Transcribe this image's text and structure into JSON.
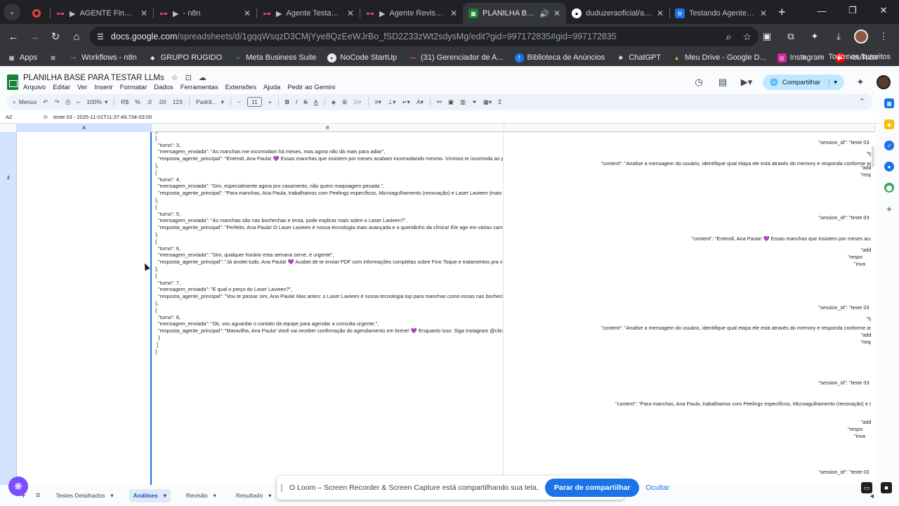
{
  "browser": {
    "tabs": [
      {
        "label": "",
        "icon": "record-icon",
        "pinned": true
      },
      {
        "label": "AGENTE Fino Toque",
        "icon": "n8n-icon",
        "prefix": "▶"
      },
      {
        "label": "- n8n",
        "icon": "n8n-icon",
        "prefix": "▶"
      },
      {
        "label": "Agente Testador de",
        "icon": "n8n-icon",
        "prefix": "▶"
      },
      {
        "label": "Agente Revisador d",
        "icon": "n8n-icon",
        "prefix": "▶"
      },
      {
        "label": "PLANILHA BASE P",
        "icon": "sheets-icon",
        "active": true
      },
      {
        "label": "duduzeraoficial/agent",
        "icon": "github-icon"
      },
      {
        "label": "Testando Agentes de",
        "icon": "gear-icon"
      }
    ],
    "url_host": "docs.google.com",
    "url_path": "/spreadsheets/d/1gqqWsqzD3CMjYye8QzEeWJrBo_fSD2Z33zWt2sdysMg/edit?gid=997172835#gid=997172835"
  },
  "bookmarks": [
    {
      "label": "Apps",
      "icon": "apps-icon"
    },
    {
      "label": "",
      "icon": "grid-icon"
    },
    {
      "label": "Workflows - n8n",
      "icon": "n8n-icon"
    },
    {
      "label": "GRUPO RUGIDO",
      "icon": "rugido-icon"
    },
    {
      "label": "Meta Business Suite",
      "icon": "meta-icon"
    },
    {
      "label": "NoCode StartUp",
      "icon": "nocode-icon"
    },
    {
      "label": "(31) Gerenciador de A...",
      "icon": "n8n-icon"
    },
    {
      "label": "Biblioteca de Anúncios",
      "icon": "facebook-icon"
    },
    {
      "label": "ChatGPT",
      "icon": "chatgpt-icon"
    },
    {
      "label": "Meu Drive - Google D...",
      "icon": "drive-icon"
    },
    {
      "label": "Instagram",
      "icon": "instagram-icon"
    },
    {
      "label": "YouTube",
      "icon": "youtube-icon"
    }
  ],
  "bookmarks_more": "»",
  "bookmarks_all": "Todos os favoritos",
  "doc": {
    "title": "PLANILHA BASE PARA TESTAR LLMs",
    "menus": [
      "Arquivo",
      "Editar",
      "Ver",
      "Inserir",
      "Formatar",
      "Dados",
      "Ferramentas",
      "Extensões",
      "Ajuda",
      "Pedir ao Gemini"
    ],
    "share_label": "Compartilhar"
  },
  "format_bar": {
    "search": "Menus",
    "zoom": "100%",
    "currency": "R$",
    "percent": "%",
    "dec_less": ".0",
    "dec_more": ".00",
    "num_fmt": "123",
    "font": "Padrã...",
    "font_size": "11"
  },
  "formula_bar": {
    "cell_ref": "A2",
    "value": "teste 03 - 2025-11-01T11:37:49.734-03:00"
  },
  "grid": {
    "columns": [
      "A",
      "B"
    ],
    "row_label": "2",
    "col_b_lines": [
      "},",
      "{",
      "  \"turno\": 3,",
      "  \"mensagem_enviada\": \"As manchas me incomodam há meses, mas agora não dá mais para adiar\",",
      "  \"resposta_agente_principal\": \"Entendi, Ana Paula! 💜 Essas manchas que insistem por meses acabam incomodando mesmo. \\n\\nIsso te incomoda ao p",
      "},",
      "{",
      "  \"turno\": 4,",
      "  \"mensagem_enviada\": \"Sim, especialmente agora pro casamento, não quero maquiagem pesada.\",",
      "  \"resposta_agente_principal\": \"Para manchas, Ana Paula, trabalhamos com Peelings específicos, Microagulhamento (renovação) e Laser Lavieen (mais av",
      "},",
      "{",
      "  \"turno\": 5,",
      "  \"mensagem_enviada\": \"As manchas são nas bochechas e testa, pode explicar mais sobre o Laser Lavieen?\",",
      "  \"resposta_agente_principal\": \"Perfeito, Ana Paula! O Laser Lavieen é nossa tecnologia mais avançada e o queridinho da clínica! Ele age em várias camad",
      "},",
      "{",
      "  \"turno\": 6,",
      "  \"mensagem_enviada\": \"Sim, qualquer horário esta semana serve, é urgente\",",
      "  \"resposta_agente_principal\": \"Já anotei tudo, Ana Paula! 💜 Acabei de te enviar PDF com informações completas sobre Fino Toque e tratamentos pra v",
      "},",
      "{",
      "  \"turno\": 7,",
      "  \"mensagem_enviada\": \"E qual o preço do Laser Lavieen?\",",
      "  \"resposta_agente_principal\": \"Vou te passar sim, Ana Paula! Mas antes: o Laser Lavieen é nossa tecnologia top para manchas como essas nas bochechas",
      "},",
      "{",
      "  \"turno\": 8,",
      "  \"mensagem_enviada\": \"Ok, vou aguardar o contato da equipe para agendar a consulta urgente.\",",
      "  \"resposta_agente_principal\": \"Maravilha, Ana Paula! Você vai receber confirmação do agendamento em breve! 💜 Enquanto isso: Siga Instagram @clin",
      "  }",
      " ]",
      "}"
    ],
    "col_c_lines": [
      "\"session_id\": \"teste 03 -",
      "\"ty",
      "\"content\": \"Analise a mensagem do usuário, identifique qual etapa ele está através do memory e responda conforme as",
      "\"addi",
      "\"resp",
      "\"session_id\": \"teste 03 -",
      "\"content\": \"Entendi, Ana Paula! 💜 Essas manchas que insistem por meses aca",
      "\"addi",
      "\"respo",
      "\"inva",
      "\"session_id\": \"teste 03 -",
      "\"ty",
      "\"content\": \"Analise a mensagem do usuário, identifique qual etapa ele está através do memory e responda conforme as",
      "\"addi",
      "\"resp",
      "\"session_id\": \"teste 03 -",
      "\"content\": \"Para manchas, Ana Paula, trabalhamos com Peelings específicos, Microagulhamento (renovação) e L",
      "\"addi",
      "\"respo",
      "\"inva",
      "\"session_id\": \"teste 03 -"
    ]
  },
  "sheet_tabs": [
    {
      "label": "Testes Detalhados",
      "active": false
    },
    {
      "label": "Análises",
      "active": true
    },
    {
      "label": "Revisão",
      "active": false
    },
    {
      "label": "Resultado",
      "active": false
    }
  ],
  "loom": {
    "message": "O Loom – Screen Recorder & Screen Capture está compartilhando sua tela.",
    "stop_label": "Parar de compartilhar",
    "hide_label": "Ocultar"
  }
}
